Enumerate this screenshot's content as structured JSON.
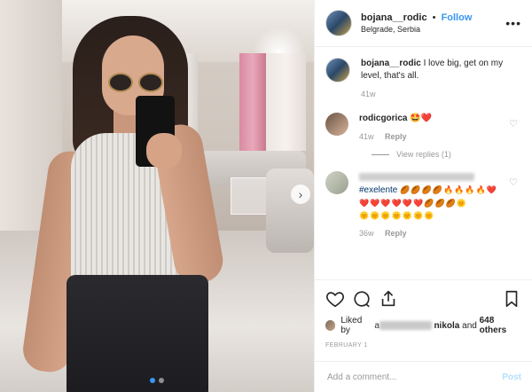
{
  "post": {
    "username": "bojana__rodic",
    "follow_label": "Follow",
    "separator": "•",
    "location": "Belgrade, Serbia",
    "more_icon": "more-options-icon",
    "caption": {
      "username": "bojana__rodic",
      "text": "I love big, get on my level, that's all.",
      "time": "41w"
    },
    "comments": [
      {
        "username": "rodicgorica",
        "text": "🤩❤️",
        "time": "41w",
        "reply_label": "Reply",
        "view_replies": "View replies (1)"
      },
      {
        "username": "",
        "hashtag": "#exelente",
        "emoji_line1": "🏉🏉🏉🏉🔥🔥🔥🔥❤️",
        "emoji_line2": "❤️❤️❤️❤️❤️❤️🏉🏉🏉🌞",
        "emoji_line3": "🌞🌞🌞🌞🌞🌞🌞",
        "time": "36w",
        "reply_label": "Reply"
      }
    ],
    "likes": {
      "prefix": "Liked by",
      "initial": "a",
      "name": "nikola",
      "conj": "and",
      "count": "648 others"
    },
    "date": "FEBRUARY 1",
    "comment_placeholder": "Add a comment...",
    "post_label": "Post",
    "colors": {
      "link_blue": "#3897f0",
      "hashtag": "#003569",
      "muted": "#999999",
      "post_disabled": "#b2dffc"
    }
  }
}
